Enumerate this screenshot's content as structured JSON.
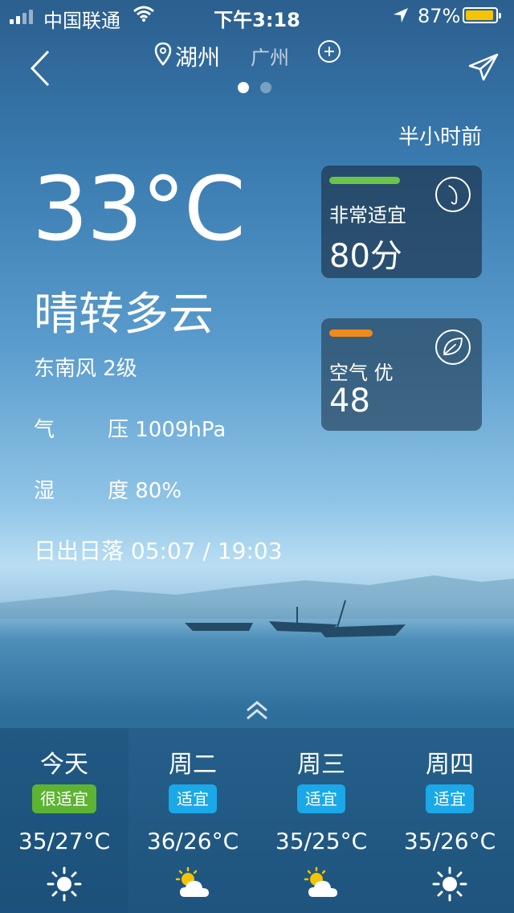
{
  "status": {
    "carrier": "中国联通",
    "time": "下午3:18",
    "battery": "87%",
    "battery_level": 0.87
  },
  "nav": {
    "city_active": "湖州",
    "city_other": "广州",
    "page_count": 2,
    "active_page": 0
  },
  "updated": "半小时前",
  "current": {
    "temperature": "33°C",
    "condition": "晴转多云",
    "wind": "东南风 2级",
    "pressure_label_1": "气",
    "pressure_label_2": "压 1009hPa",
    "humidity_label_1": "湿",
    "humidity_label_2": "度 80%",
    "sun": "日出日落 05:07 / 19:03"
  },
  "cards": [
    {
      "label": "非常适宜",
      "value": "80分",
      "bar_color": "#6ac44a",
      "icon": "fishing-icon"
    },
    {
      "label": "空气 优",
      "value": "48",
      "bar_color": "#f08a1c",
      "icon": "leaf-icon"
    }
  ],
  "forecast": [
    {
      "day": "今天",
      "badge": "很适宜",
      "badge_color": "#5cb432",
      "temp": "35/27°C",
      "icon": "sun-icon"
    },
    {
      "day": "周二",
      "badge": "适宜",
      "badge_color": "#1aa8e8",
      "temp": "36/26°C",
      "icon": "partly-cloudy-icon"
    },
    {
      "day": "周三",
      "badge": "适宜",
      "badge_color": "#1aa8e8",
      "temp": "35/25°C",
      "icon": "partly-cloudy-icon"
    },
    {
      "day": "周四",
      "badge": "适宜",
      "badge_color": "#1aa8e8",
      "temp": "35/26°C",
      "icon": "sun-icon"
    }
  ]
}
